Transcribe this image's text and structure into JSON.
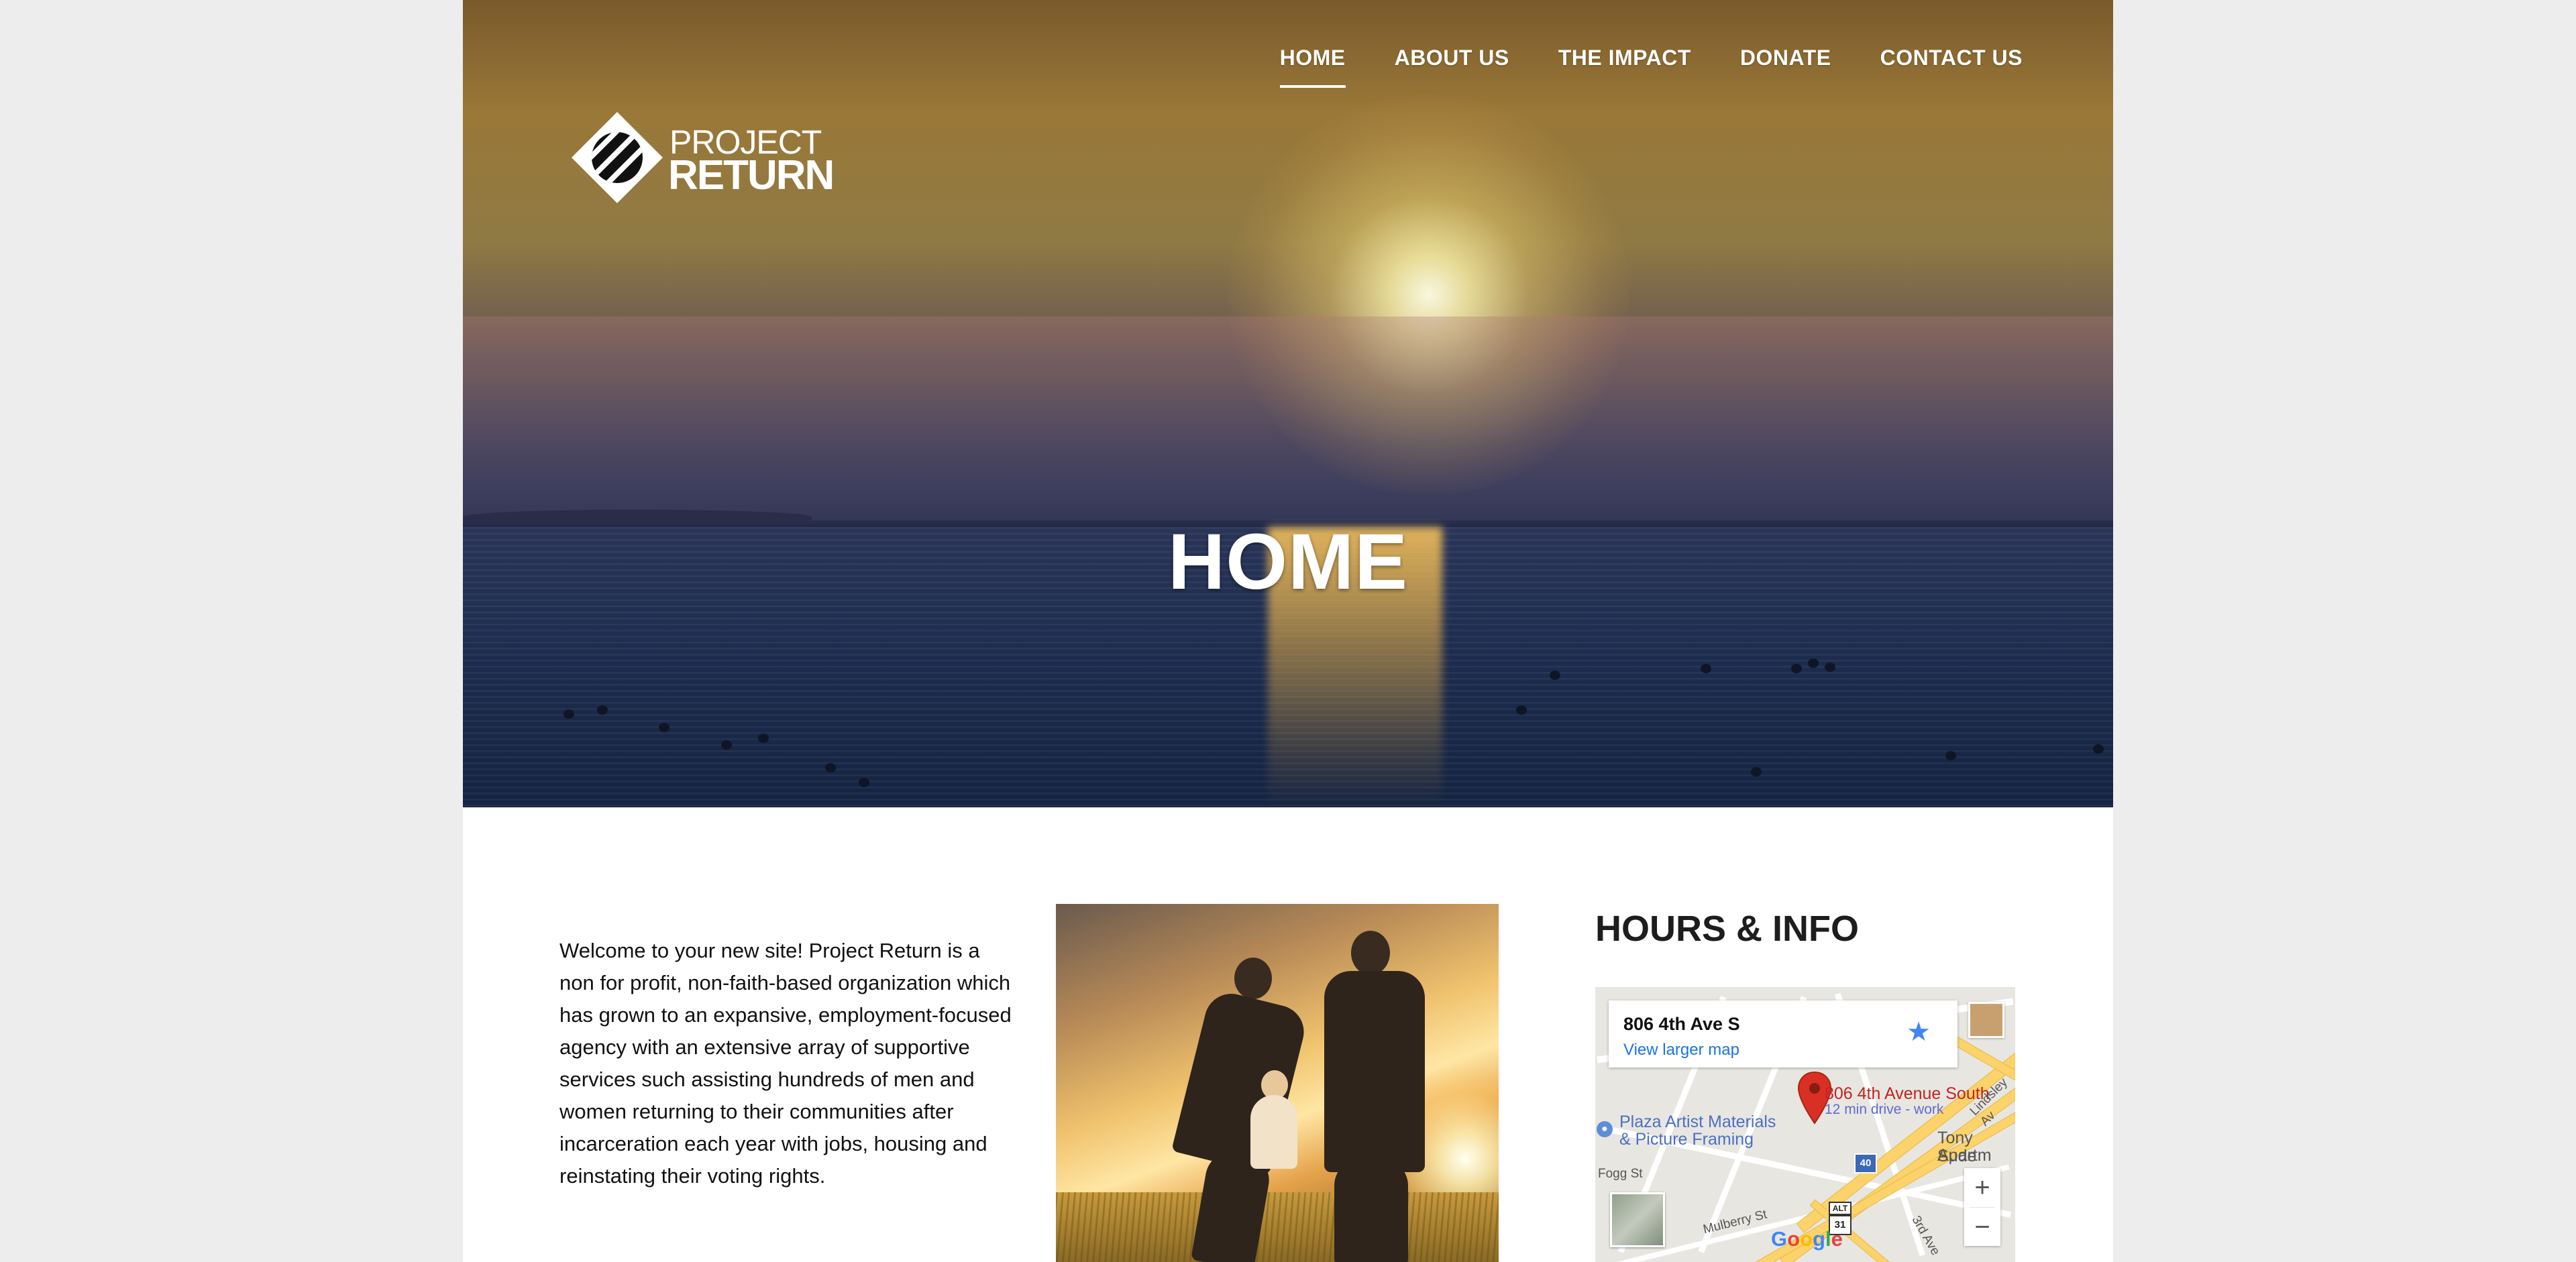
{
  "nav": {
    "items": [
      {
        "label": "HOME",
        "active": true
      },
      {
        "label": "ABOUT US",
        "active": false
      },
      {
        "label": "THE IMPACT",
        "active": false
      },
      {
        "label": "DONATE",
        "active": false
      },
      {
        "label": "CONTACT US",
        "active": false
      }
    ]
  },
  "logo": {
    "line1": "PROJECT",
    "line2": "RETURN"
  },
  "hero": {
    "title": "HOME"
  },
  "welcome": {
    "text": "Welcome to your new site! Project Return is a non for profit, non-faith-based organization which has grown to an expansive, employment-focused agency with an extensive array of supportive services such assisting hundreds of men and women returning to their communities after incarceration each year with jobs, housing and reinstating their voting rights."
  },
  "hours": {
    "title": "HOURS & INFO"
  },
  "map": {
    "card_address": "806 4th Ave S",
    "card_link": "View larger map",
    "pin_label": "806 4th Avenue South",
    "pin_sub": "12 min drive - work",
    "poi_1": "Plaza Artist Materials",
    "poi_2": "& Picture Framing",
    "poi_3": "Tony Sude",
    "poi_4": "Apartm",
    "street_1": "Fogg St",
    "street_2": "Mulberry St",
    "street_3": "Lindsley Av",
    "street_4": "3rd Ave",
    "shield_1": "40",
    "shield_2": "ALT",
    "shield_3": "31",
    "zoom_in": "+",
    "zoom_out": "−",
    "google": "Google"
  },
  "colors": {
    "page_bg": "#ededed",
    "link": "#1a73e8",
    "pin": "#d93025"
  }
}
